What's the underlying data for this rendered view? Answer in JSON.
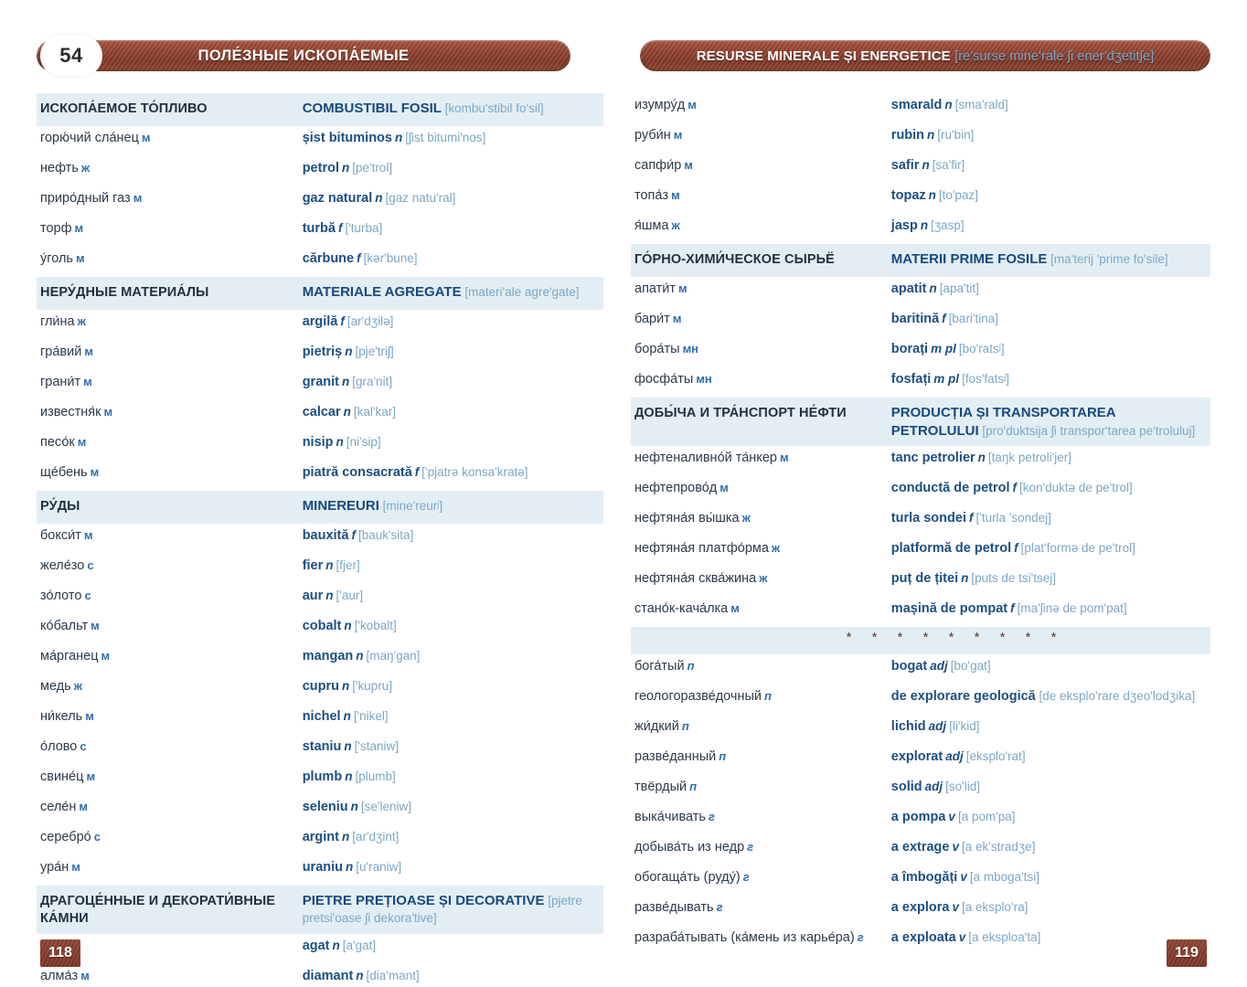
{
  "left_page": {
    "chapter_number": "54",
    "banner_title": "ПОЛЕ́ЗНЫЕ ИСКОПА́ЕМЫЕ",
    "folio": "118",
    "rows": [
      {
        "type": "heading",
        "ru": "ИСКОПА́ЕМОЕ ТО́ПЛИВО",
        "ro": "COMBUSTIBIL FOSIL",
        "ipa": "[kombu'stibil fo'sil]"
      },
      {
        "type": "entry",
        "ru": "горю́чий сла́нец",
        "gender": "м",
        "ro": "șist bituminos",
        "pos": "n",
        "ipa": "[ʃist bitumi'nos]"
      },
      {
        "type": "entry",
        "ru": "нефть",
        "gender": "ж",
        "ro": "petrol",
        "pos": "n",
        "ipa": "[pe'trol]"
      },
      {
        "type": "entry",
        "ru": "приро́дный газ",
        "gender": "м",
        "ro": "gaz natural",
        "pos": "n",
        "ipa": "[gaz natu'ral]"
      },
      {
        "type": "entry",
        "ru": "торф",
        "gender": "м",
        "ro": "turbă",
        "pos": "f",
        "ipa": "['turba]"
      },
      {
        "type": "entry",
        "ru": "у́голь",
        "gender": "м",
        "ro": "cărbune",
        "pos": "f",
        "ipa": "[kər'bune]"
      },
      {
        "type": "heading",
        "ru": "НЕРУ́ДНЫЕ МАТЕРИА́ЛЫ",
        "ro": "MATERIALE AGREGATE",
        "ipa": "[materi'ale agre'gate]"
      },
      {
        "type": "entry",
        "ru": "гли́на",
        "gender": "ж",
        "ro": "argilă",
        "pos": "f",
        "ipa": "[ar'dʒilə]"
      },
      {
        "type": "entry",
        "ru": "гра́вий",
        "gender": "м",
        "ro": "pietriș",
        "pos": "n",
        "ipa": "[pje'triʃ]"
      },
      {
        "type": "entry",
        "ru": "грани́т",
        "gender": "м",
        "ro": "granit",
        "pos": "n",
        "ipa": "[gra'nit]"
      },
      {
        "type": "entry",
        "ru": "известня́к",
        "gender": "м",
        "ro": "calcar",
        "pos": "n",
        "ipa": "[kal'kar]"
      },
      {
        "type": "entry",
        "ru": "песо́к",
        "gender": "м",
        "ro": "nisip",
        "pos": "n",
        "ipa": "[ni'sip]"
      },
      {
        "type": "entry",
        "ru": "ще́бень",
        "gender": "м",
        "ro": "piatră consacrată",
        "pos": "f",
        "ipa": "['pjatrə konsa'kratə]"
      },
      {
        "type": "heading",
        "ru": "РУ́ДЫ",
        "ro": "MINEREURI",
        "ipa": "[mine'reurʲ]"
      },
      {
        "type": "entry",
        "ru": "бокси́т",
        "gender": "м",
        "ro": "bauxită",
        "pos": "f",
        "ipa": "[bauk'sita]"
      },
      {
        "type": "entry",
        "ru": "желе́зо",
        "gender": "с",
        "ro": "fier",
        "pos": "n",
        "ipa": "[fjer]"
      },
      {
        "type": "entry",
        "ru": "зо́лото",
        "gender": "с",
        "ro": "aur",
        "pos": "n",
        "ipa": "['aur]"
      },
      {
        "type": "entry",
        "ru": "ко́бальт",
        "gender": "м",
        "ro": "cobalt",
        "pos": "n",
        "ipa": "['kobalt]"
      },
      {
        "type": "entry",
        "ru": "ма́рганец",
        "gender": "м",
        "ro": "mangan",
        "pos": "n",
        "ipa": "[maŋ'gan]"
      },
      {
        "type": "entry",
        "ru": "медь",
        "gender": "ж",
        "ro": "cupru",
        "pos": "n",
        "ipa": "['kupru]"
      },
      {
        "type": "entry",
        "ru": "ни́кель",
        "gender": "м",
        "ro": "nichel",
        "pos": "n",
        "ipa": "['nikel]"
      },
      {
        "type": "entry",
        "ru": "о́лово",
        "gender": "с",
        "ro": "staniu",
        "pos": "n",
        "ipa": "['staniw]"
      },
      {
        "type": "entry",
        "ru": "свине́ц",
        "gender": "м",
        "ro": "plumb",
        "pos": "n",
        "ipa": "[plumb]"
      },
      {
        "type": "entry",
        "ru": "селе́н",
        "gender": "м",
        "ro": "seleniu",
        "pos": "n",
        "ipa": "[se'leniw]"
      },
      {
        "type": "entry",
        "ru": "серебро́",
        "gender": "с",
        "ro": "argint",
        "pos": "n",
        "ipa": "[ar'dʒint]"
      },
      {
        "type": "entry",
        "ru": "ура́н",
        "gender": "м",
        "ro": "uraniu",
        "pos": "n",
        "ipa": "[u'raniw]"
      },
      {
        "type": "heading2",
        "ru": "ДРАГОЦЕ́ННЫЕ И ДЕКОРАТИ́ВНЫЕ КА́МНИ",
        "ro": "PIETRE PREȚIOASE ȘI DECORATIVE",
        "ipa": "[pjetre pretsi'oase ʃi dekora'tive]"
      },
      {
        "type": "entry",
        "ru": "ага́т",
        "gender": "м",
        "ro": "agat",
        "pos": "n",
        "ipa": "[a'gat]"
      },
      {
        "type": "entry",
        "ru": "алма́з",
        "gender": "м",
        "ro": "diamant",
        "pos": "n",
        "ipa": "[dia'mant]"
      }
    ]
  },
  "right_page": {
    "banner_title": "RESURSE MINERALE ȘI ENERGETICE",
    "banner_ipa": "[re'surse mine'rale ʃi ener'dʒetitʃe]",
    "folio": "119",
    "stars": "* * * * * * * * *",
    "rows": [
      {
        "type": "entry",
        "ru": "изумру́д",
        "gender": "м",
        "ro": "smarald",
        "pos": "n",
        "ipa": "[sma'rald]"
      },
      {
        "type": "entry",
        "ru": "руби́н",
        "gender": "м",
        "ro": "rubin",
        "pos": "n",
        "ipa": "[ru'bin]"
      },
      {
        "type": "entry",
        "ru": "сапфи́р",
        "gender": "м",
        "ro": "safir",
        "pos": "n",
        "ipa": "[sa'fir]"
      },
      {
        "type": "entry",
        "ru": "топа́з",
        "gender": "м",
        "ro": "topaz",
        "pos": "n",
        "ipa": "[to'paz]"
      },
      {
        "type": "entry",
        "ru": "я́шма",
        "gender": "ж",
        "ro": "jasp",
        "pos": "n",
        "ipa": "[ʒasp]"
      },
      {
        "type": "heading",
        "ru": "ГО́РНО-ХИМИ́ЧЕСКОЕ СЫРЬЁ",
        "ro": "MATERII PRIME FOSILE",
        "ipa": "[ma'terij 'prime fo'sile]"
      },
      {
        "type": "entry",
        "ru": "апати́т",
        "gender": "м",
        "ro": "apatit",
        "pos": "n",
        "ipa": "[apa'tit]"
      },
      {
        "type": "entry",
        "ru": "бари́т",
        "gender": "м",
        "ro": "baritină",
        "pos": "f",
        "ipa": "[bari'tina]"
      },
      {
        "type": "entry",
        "ru": "бора́ты",
        "gender": "мн",
        "ro": "borați",
        "pos": "m pl",
        "ipa": "[bo'ratsʲ]"
      },
      {
        "type": "entry",
        "ru": "фосфа́ты",
        "gender": "мн",
        "ro": "fosfați",
        "pos": "m pl",
        "ipa": "[fos'fatsʲ]"
      },
      {
        "type": "heading2",
        "ru": "ДОБЫ́ЧА И ТРА́НСПОРТ НЕ́ФТИ",
        "ro": "PRODUCȚIA ȘI TRANSPORTAREA PETROLULUI",
        "ipa": "[pro'duktsija ʃi transpor'tarea pe'troluluj]"
      },
      {
        "type": "entry",
        "ru": "нефтеналивно́й та́нкер",
        "gender": "м",
        "ro": "tanc petrolier",
        "pos": "n",
        "ipa": "[taŋk petroli'jer]"
      },
      {
        "type": "entry",
        "ru": "нефтепрово́д",
        "gender": "м",
        "ro": "conductă de petrol",
        "pos": "f",
        "ipa": "[kon'duktə de pe'trol]"
      },
      {
        "type": "entry",
        "ru": "нефтяна́я вы́шка",
        "gender": "ж",
        "ro": "turla sondei",
        "pos": "f",
        "ipa": "['turla 'sondej]"
      },
      {
        "type": "entry",
        "ru": "нефтяна́я платфо́рма",
        "gender": "ж",
        "ro": "platformă de petrol",
        "pos": "f",
        "ipa": "[plat'formə de pe'trol]"
      },
      {
        "type": "entry",
        "ru": "нефтяна́я сква́жина",
        "gender": "ж",
        "ro": "puț de țitei",
        "pos": "n",
        "ipa": "[puts de tsi'tsej]"
      },
      {
        "type": "entry",
        "ru": "стано́к-кача́лка",
        "gender": "м",
        "ro": "mașină de pompat",
        "pos": "f",
        "ipa": "[ma'ʃinə de pom'pat]"
      },
      {
        "type": "stars"
      },
      {
        "type": "entry",
        "ru": "бога́тый",
        "gender": "п",
        "ro": "bogat",
        "pos": "adj",
        "ipa": "[bo'gat]"
      },
      {
        "type": "entry",
        "ru": "геологоразве́дочный",
        "gender": "п",
        "ro": "de explorare geologică",
        "pos": "",
        "ipa": "[de eksplo'rare dʒeo'lodʒika]"
      },
      {
        "type": "entry",
        "ru": "жи́дкий",
        "gender": "п",
        "ro": "lichid",
        "pos": "adj",
        "ipa": "[li'kid]"
      },
      {
        "type": "entry",
        "ru": "разве́данный",
        "gender": "п",
        "ro": "explorat",
        "pos": "adj",
        "ipa": "[eksplo'rat]"
      },
      {
        "type": "entry",
        "ru": "твёрдый",
        "gender": "п",
        "ro": "solid",
        "pos": "adj",
        "ipa": "[so'lid]"
      },
      {
        "type": "entry",
        "ru": "выка́чивать",
        "gender": "г",
        "ro": "a pompa",
        "pos": "v",
        "ipa": "[a pom'pa]"
      },
      {
        "type": "entry",
        "ru": "добыва́ть из недр",
        "gender": "г",
        "ro": "a extrage",
        "pos": "v",
        "ipa": "[a ek'stradʒe]"
      },
      {
        "type": "entry",
        "ru": "обогаща́ть (руду́)",
        "gender": "г",
        "ro": "a îmbogăți",
        "pos": "v",
        "ipa": "[a mboga'tsi]"
      },
      {
        "type": "entry",
        "ru": "разве́дывать",
        "gender": "г",
        "ro": "a explora",
        "pos": "v",
        "ipa": "[a eksplo'ra]"
      },
      {
        "type": "entry",
        "ru": "разраба́тывать (ка́мень из карье́ра)",
        "gender": "г",
        "ro": "a exploata",
        "pos": "v",
        "ipa": "[a eksploa'ta]"
      }
    ]
  }
}
